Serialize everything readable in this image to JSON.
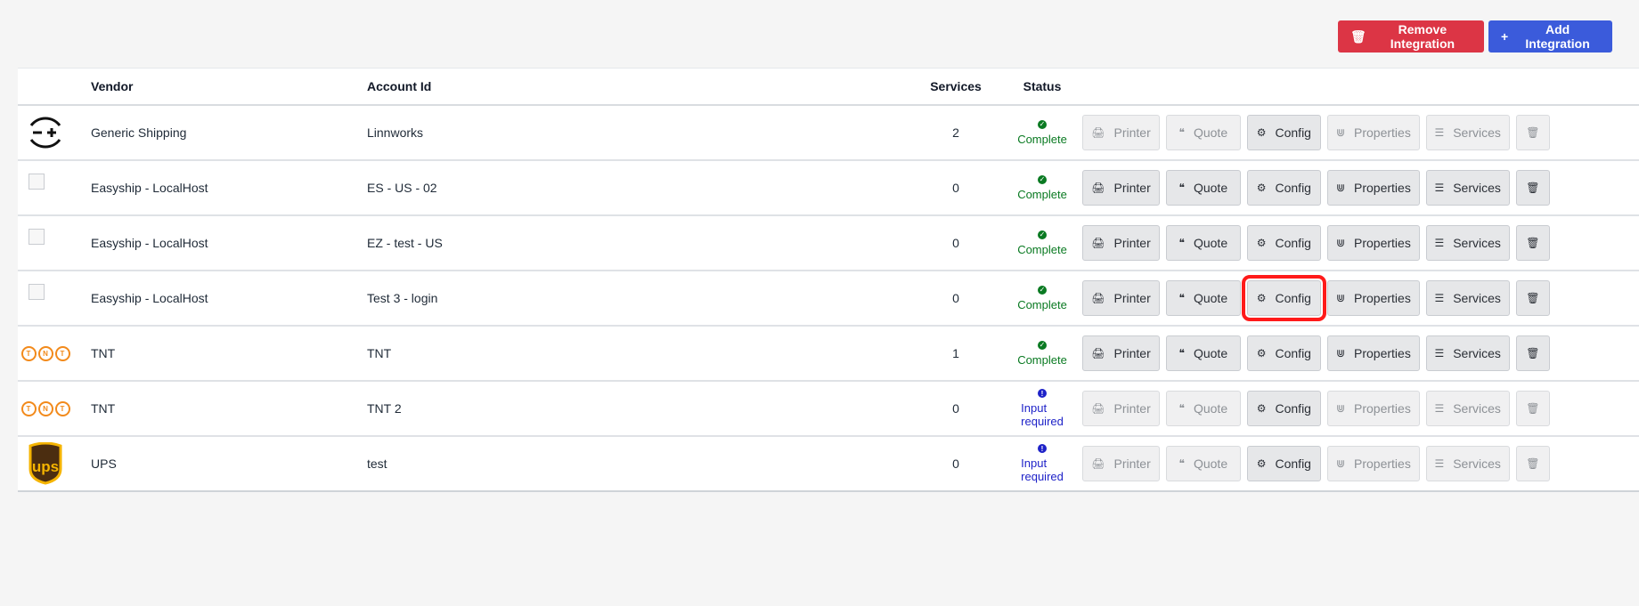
{
  "toolbar": {
    "remove_label": "Remove Integration",
    "add_label": "Add Integration"
  },
  "table": {
    "headers": [
      "",
      "Vendor",
      "Account Id",
      "Services",
      "Status",
      ""
    ],
    "rows": [
      {
        "logo": "generic-shipping-icon",
        "vendor": "Generic Shipping",
        "account": "Linnworks",
        "services": "2",
        "status": "Complete",
        "status_type": "ok",
        "enabled": false
      },
      {
        "logo": "broken-image-icon",
        "vendor": "Easyship - LocalHost",
        "account": "ES - US - 02",
        "services": "0",
        "status": "Complete",
        "status_type": "ok",
        "enabled": true
      },
      {
        "logo": "broken-image-icon",
        "vendor": "Easyship - LocalHost",
        "account": "EZ - test - US",
        "services": "0",
        "status": "Complete",
        "status_type": "ok",
        "enabled": true
      },
      {
        "logo": "broken-image-icon",
        "vendor": "Easyship - LocalHost",
        "account": "Test 3 - login",
        "services": "0",
        "status": "Complete",
        "status_type": "ok",
        "enabled": true
      },
      {
        "logo": "tnt-logo-icon",
        "vendor": "TNT",
        "account": "TNT",
        "services": "1",
        "status": "Complete",
        "status_type": "ok",
        "enabled": true
      },
      {
        "logo": "tnt-logo-icon",
        "vendor": "TNT",
        "account": "TNT 2",
        "services": "0",
        "status": "Input required",
        "status_type": "warn",
        "enabled": false
      },
      {
        "logo": "ups-logo-icon",
        "vendor": "UPS",
        "account": "test",
        "services": "0",
        "status": "Input required",
        "status_type": "warn",
        "enabled": false
      }
    ]
  },
  "actions": {
    "printer": "Printer",
    "quote": "Quote",
    "config": "Config",
    "properties": "Properties",
    "services": "Services"
  },
  "colors": {
    "remove": "#dc3545",
    "add": "#3b5bdb",
    "complete": "#0a7a22",
    "input_required": "#1e22c8",
    "highlight": "#ff1a1a"
  }
}
